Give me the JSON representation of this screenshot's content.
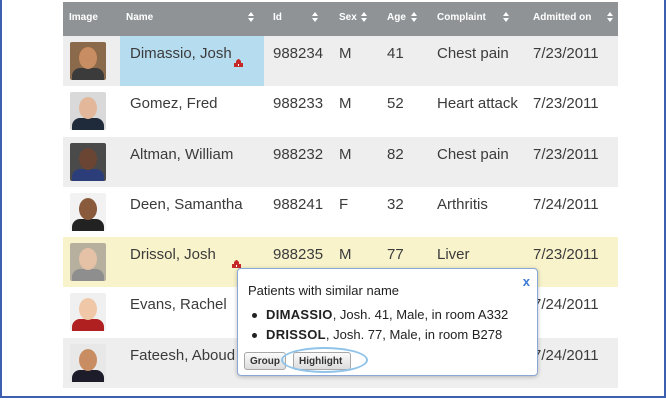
{
  "columns": [
    {
      "label": "Image",
      "sortable": false
    },
    {
      "label": "Name",
      "sortable": true
    },
    {
      "label": "Id",
      "sortable": true
    },
    {
      "label": "Sex",
      "sortable": true
    },
    {
      "label": "Age",
      "sortable": true
    },
    {
      "label": "Complaint",
      "sortable": true
    },
    {
      "label": "Admitted on",
      "sortable": true
    }
  ],
  "patients": [
    {
      "name": "Dimassio, Josh",
      "id": "988234",
      "sex": "M",
      "age": "41",
      "complaint": "Chest pain",
      "admitted": "7/23/2011",
      "state": "selected",
      "similar_flag": true
    },
    {
      "name": "Gomez, Fred",
      "id": "988233",
      "sex": "M",
      "age": "52",
      "complaint": "Heart attack",
      "admitted": "7/23/2011",
      "state": "normal",
      "similar_flag": false
    },
    {
      "name": "Altman, William",
      "id": "988232",
      "sex": "M",
      "age": "82",
      "complaint": "Chest pain",
      "admitted": "7/23/2011",
      "state": "normal",
      "similar_flag": false
    },
    {
      "name": "Deen, Samantha",
      "id": "988241",
      "sex": "F",
      "age": "32",
      "complaint": "Arthritis",
      "admitted": "7/24/2011",
      "state": "normal",
      "similar_flag": false
    },
    {
      "name": "Drissol, Josh",
      "id": "988235",
      "sex": "M",
      "age": "77",
      "complaint": "Liver",
      "admitted": "7/23/2011",
      "state": "highlighted",
      "similar_flag": true
    },
    {
      "name": "Evans, Rachel",
      "id": "",
      "sex": "",
      "age": "",
      "complaint": "",
      "admitted": "7/24/2011",
      "state": "normal",
      "similar_flag": false
    },
    {
      "name": "Fateesh, Aboud",
      "id": "",
      "sex": "",
      "age": "",
      "complaint": "",
      "admitted": "7/24/2011",
      "state": "normal",
      "similar_flag": false
    }
  ],
  "popup": {
    "title": "Patients with similar name",
    "close": "x",
    "items": [
      {
        "name": "DIMASSIO",
        "detail": ", Josh. 41, Male, in room A332"
      },
      {
        "name": "DRISSOL",
        "detail": ", Josh. 77, Male, in room B278"
      }
    ],
    "group_button": "Group",
    "highlight_button": "Highlight"
  },
  "colors": {
    "header_bg": "#8f9396",
    "selected_name_bg": "#b6dcef",
    "highlight_row_bg": "#f8f3cb",
    "warning_icon": "#c62828",
    "frame_border": "#3d5fb0"
  },
  "avatars": [
    {
      "skin": "#c98d63",
      "shirt": "#3b3b3b",
      "bg": "#8a6a4a"
    },
    {
      "skin": "#e3b89a",
      "shirt": "#1f2a3a",
      "bg": "#d9d9d9"
    },
    {
      "skin": "#6b4533",
      "shirt": "#2c3e7a",
      "bg": "#4a4a4a"
    },
    {
      "skin": "#8a5a3c",
      "shirt": "#222222",
      "bg": "#f2f2f2"
    },
    {
      "skin": "#e5c1a6",
      "shirt": "#8e8e8e",
      "bg": "#b7b09e"
    },
    {
      "skin": "#f0c8a8",
      "shirt": "#b02020",
      "bg": "#f0f0f0"
    },
    {
      "skin": "#c98d63",
      "shirt": "#1c1c2a",
      "bg": "#e8e8e8"
    }
  ]
}
